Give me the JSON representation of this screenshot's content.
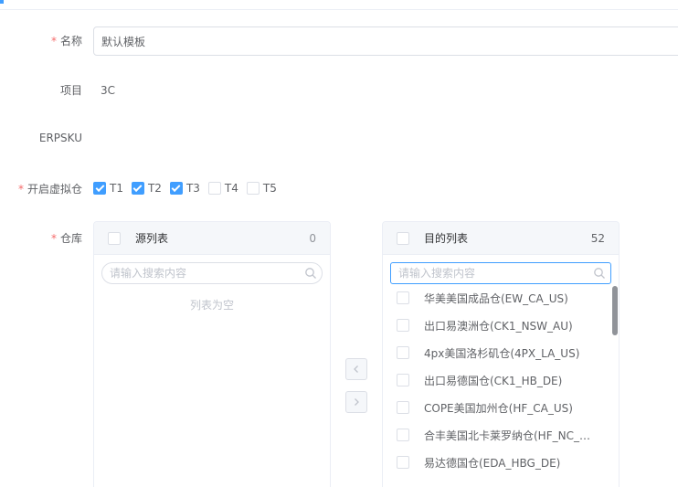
{
  "form": {
    "name_label": "名称",
    "name_value": "默认模板",
    "project_label": "项目",
    "project_value": "3C",
    "erpsku_label": "ERPSKU",
    "virtual_label": "开启虚拟仓",
    "warehouse_label": "仓库",
    "required_mark": "*"
  },
  "virtual_options": [
    {
      "label": "T1",
      "checked": true
    },
    {
      "label": "T2",
      "checked": true
    },
    {
      "label": "T3",
      "checked": true
    },
    {
      "label": "T4",
      "checked": false
    },
    {
      "label": "T5",
      "checked": false
    }
  ],
  "transfer": {
    "source": {
      "title": "源列表",
      "count": "0",
      "search_placeholder": "请输入搜索内容",
      "empty_text": "列表为空"
    },
    "target": {
      "title": "目的列表",
      "count": "52",
      "search_placeholder": "请输入搜索内容",
      "items": [
        "华美美国成品仓(EW_CA_US)",
        "出口易澳洲仓(CK1_NSW_AU)",
        "4px美国洛杉矶仓(4PX_LA_US)",
        "出口易德国仓(CK1_HB_DE)",
        "COPE美国加州仓(HF_CA_US)",
        "合丰美国北卡莱罗纳仓(HF_NC_U...",
        "易达德国仓(EDA_HBG_DE)"
      ]
    },
    "to_left_icon": "chevron-left-icon",
    "to_right_icon": "chevron-right-icon"
  },
  "colors": {
    "primary": "#409eff",
    "required": "#f56c6c",
    "border": "#dcdfe6"
  }
}
